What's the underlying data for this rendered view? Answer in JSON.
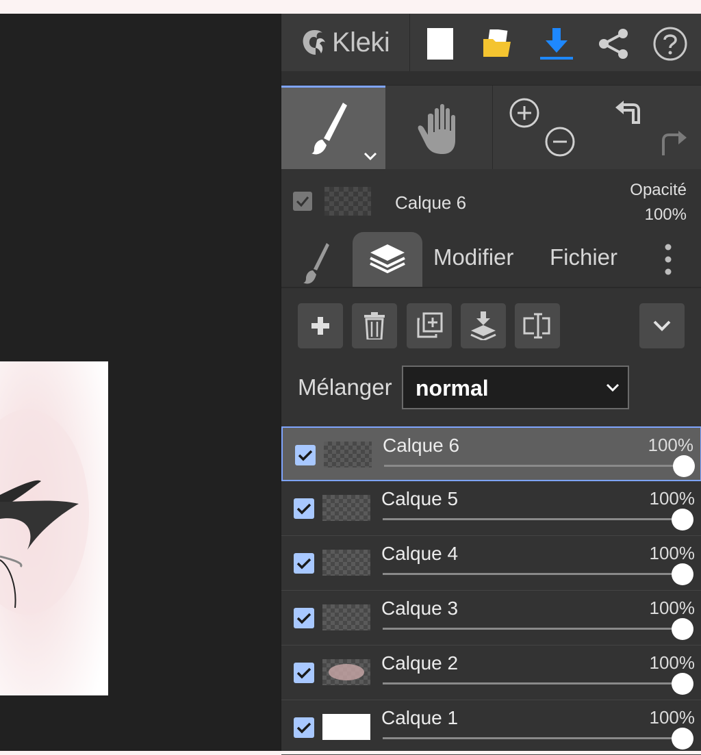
{
  "app": {
    "name": "Kleki"
  },
  "toolbar": {
    "new_icon": "new-image-icon",
    "open_icon": "open-folder-icon",
    "save_icon": "download-icon",
    "share_icon": "share-icon",
    "help_icon": "help-icon"
  },
  "current_layer": {
    "name": "Calque 6",
    "opacity_label": "Opacité",
    "opacity_value": "100%"
  },
  "tabs": {
    "edit_label": "Modifier",
    "file_label": "Fichier"
  },
  "blend": {
    "label": "Mélanger",
    "value": "normal"
  },
  "layers": [
    {
      "name": "Calque 6",
      "opacity": "100%",
      "opacity_fraction": 1.0,
      "visible": true,
      "active": true
    },
    {
      "name": "Calque 5",
      "opacity": "100%",
      "opacity_fraction": 1.0,
      "visible": true,
      "active": false
    },
    {
      "name": "Calque 4",
      "opacity": "100%",
      "opacity_fraction": 1.0,
      "visible": true,
      "active": false
    },
    {
      "name": "Calque 3",
      "opacity": "100%",
      "opacity_fraction": 1.0,
      "visible": true,
      "active": false
    },
    {
      "name": "Calque 2",
      "opacity": "100%",
      "opacity_fraction": 1.0,
      "visible": true,
      "active": false
    },
    {
      "name": "Calque 1",
      "opacity": "100%",
      "opacity_fraction": 1.0,
      "visible": true,
      "active": false
    }
  ],
  "colors": {
    "accent": "#7fa5ff",
    "save_blue": "#1e88ff",
    "folder_yellow": "#f4c430"
  }
}
